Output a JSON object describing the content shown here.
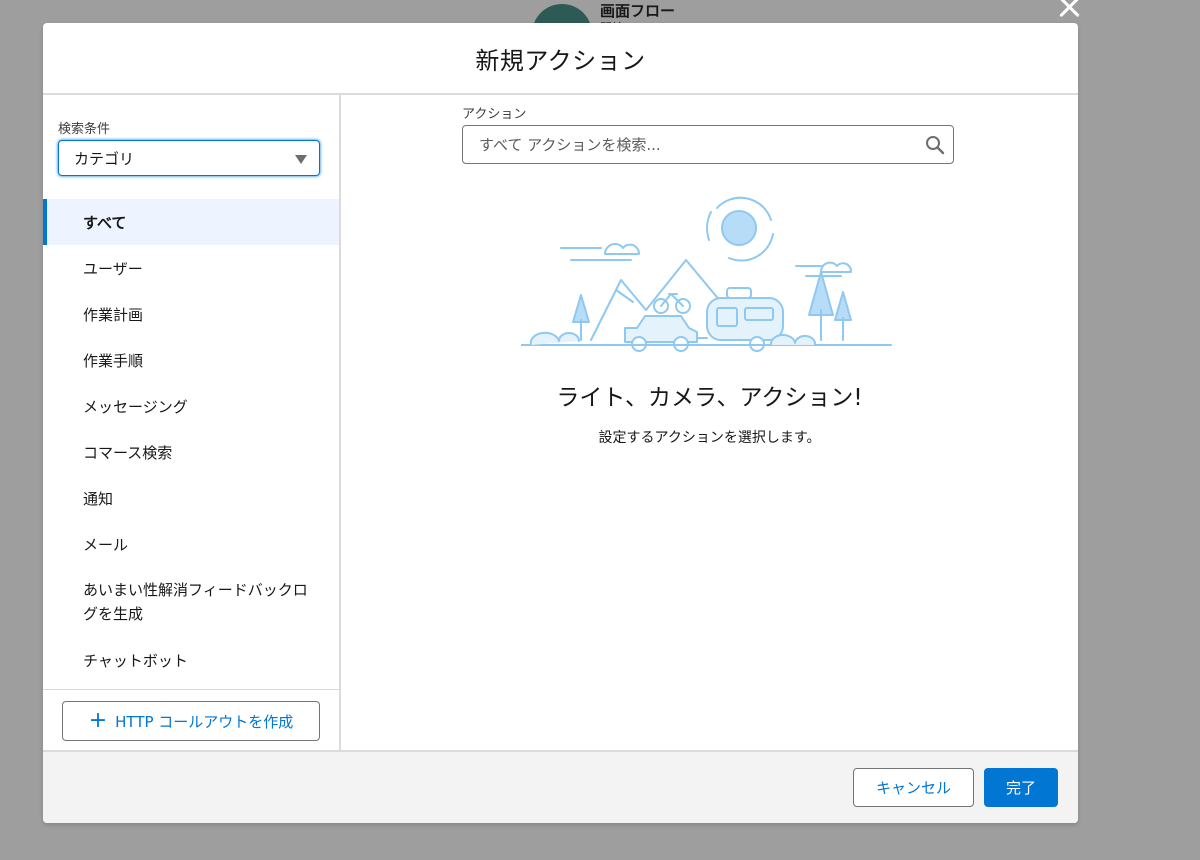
{
  "background": {
    "node_title": "画面フロー",
    "node_subtitle": "開始"
  },
  "modal": {
    "title": "新規アクション"
  },
  "sidebar": {
    "filter_label": "検索条件",
    "category_value": "カテゴリ",
    "items": [
      {
        "label": "すべて",
        "active": true
      },
      {
        "label": "ユーザー"
      },
      {
        "label": "作業計画"
      },
      {
        "label": "作業手順"
      },
      {
        "label": "メッセージング"
      },
      {
        "label": "コマース検索"
      },
      {
        "label": "通知"
      },
      {
        "label": "メール"
      },
      {
        "label": "あいまい性解消フィードバックログを生成"
      },
      {
        "label": "チャットボット"
      }
    ],
    "http_button_label": "HTTP コールアウトを作成"
  },
  "main": {
    "search_label": "アクション",
    "search_placeholder": "すべて アクションを検索...",
    "empty_title": "ライト、カメラ、アクション!",
    "empty_subtitle": "設定するアクションを選択します。"
  },
  "footer": {
    "cancel_label": "キャンセル",
    "done_label": "完了"
  },
  "colors": {
    "brand": "#0176d3",
    "illustration": "#8fc8f0"
  },
  "icons": {
    "search": "search-icon",
    "caret": "chevron-down-icon",
    "add": "plus-icon",
    "close": "close-icon"
  }
}
